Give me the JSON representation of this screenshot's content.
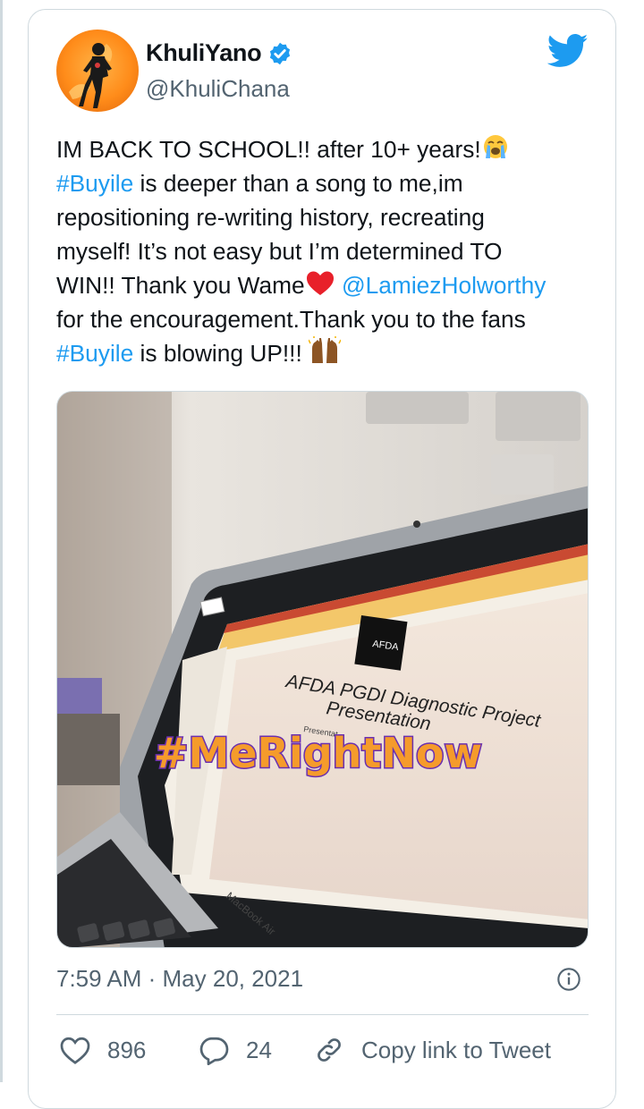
{
  "user": {
    "display_name": "KhuliYano",
    "handle": "@KhuliChana",
    "verified": true
  },
  "tweet": {
    "line1": "IM BACK TO SCHOOL!! after 10+ years!",
    "hashtag1": "#Buyile",
    "line2_rest": " is deeper than a song to me,im",
    "line3": "repositioning re-writing history, recreating",
    "line4": "myself! It’s not easy but I’m determined TO",
    "line5a": "WIN!! Thank you Wame",
    "mention": "@LamiezHolworthy",
    "line6": "for the encouragement.Thank you to the fans",
    "hashtag2": "#Buyile",
    "line7_rest": " is blowing UP!!! ",
    "emoji_cry": "loudly-crying-face-emoji",
    "emoji_heart": "red-heart-emoji",
    "emoji_hands": "raising-hands-emoji"
  },
  "media": {
    "slide_logo": "AFDA",
    "slide_title_line1": "AFDA PGDI Diagnostic Project",
    "slide_title_line2": "Presentation",
    "slide_sub": "Presentat",
    "overlay": "#MeRightNow",
    "laptop_label": "MacBook Air"
  },
  "meta": {
    "time": "7:59 AM",
    "separator": " · ",
    "date": "May 20, 2021"
  },
  "actions": {
    "likes": "896",
    "replies": "24",
    "copy_link": "Copy link to Tweet"
  },
  "colors": {
    "link": "#1d9bf0",
    "text": "#0f1419",
    "secondary": "#536471",
    "border": "#cfd9de",
    "overlay_text": "#f59b2b",
    "overlay_stroke": "#6a2fb0"
  }
}
